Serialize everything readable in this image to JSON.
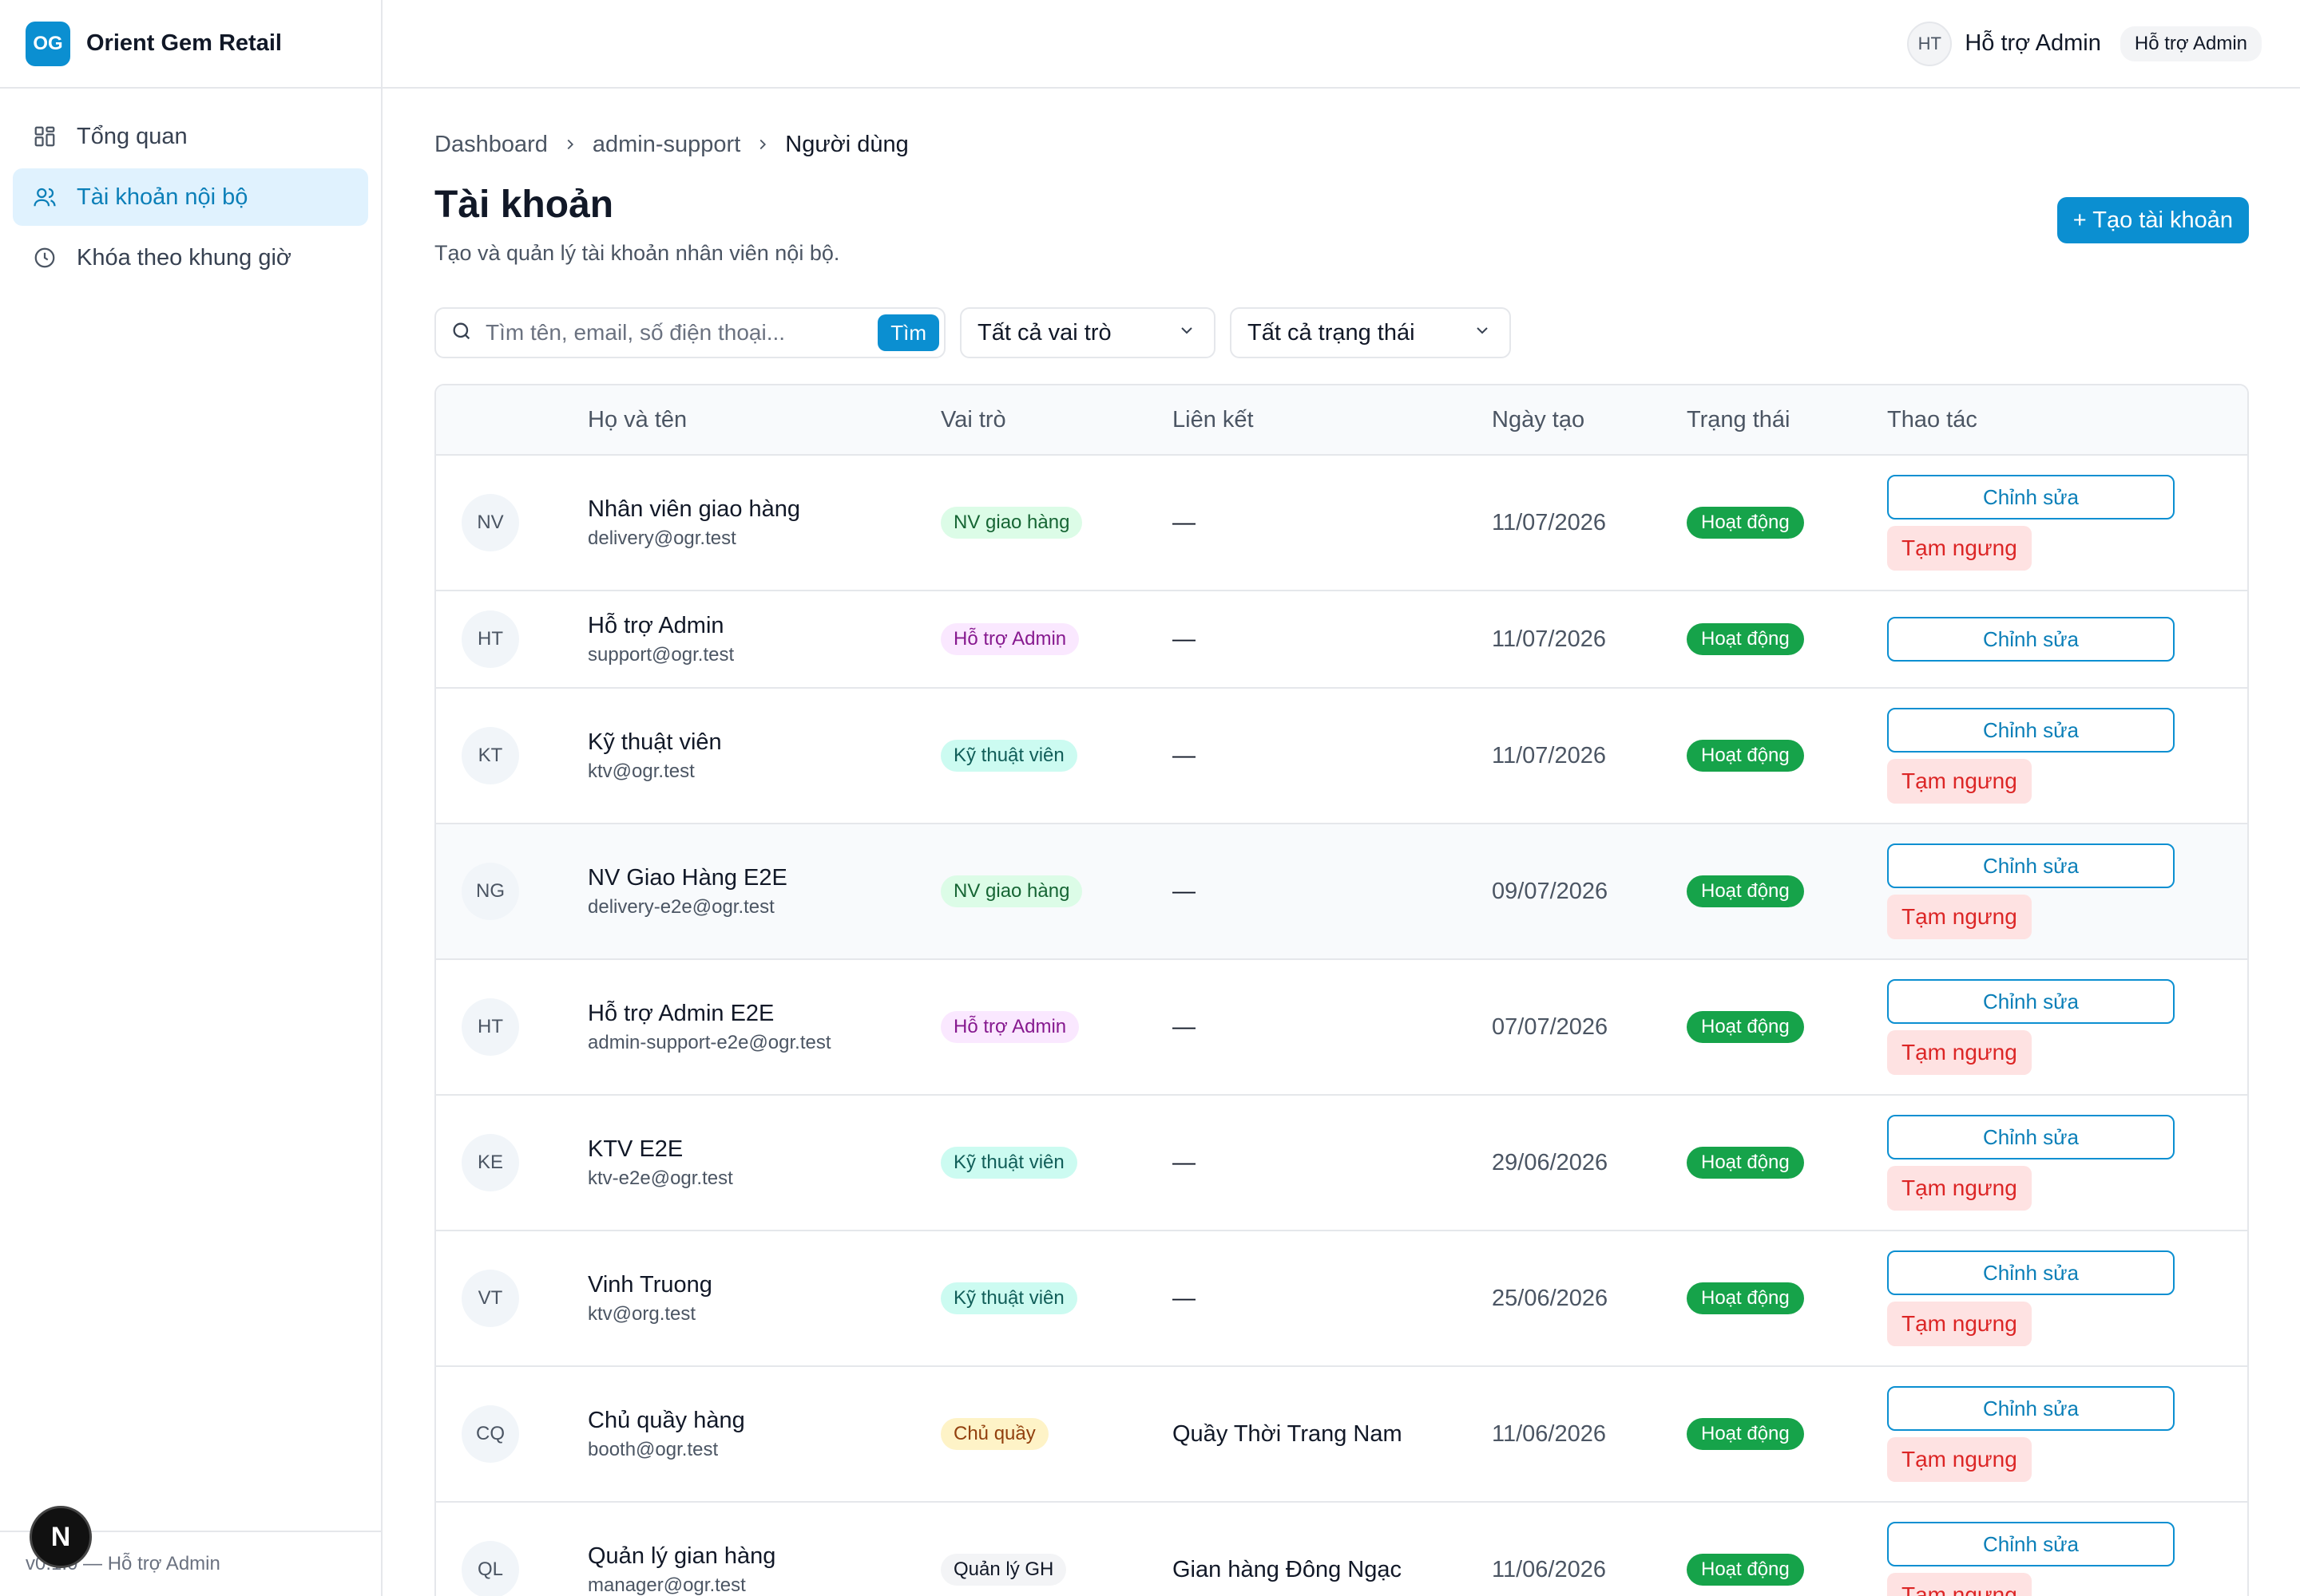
{
  "brand": {
    "logo": "OG",
    "name": "Orient Gem Retail"
  },
  "sidebar": {
    "items": [
      {
        "label": "Tổng quan",
        "icon": "grid-icon"
      },
      {
        "label": "Tài khoản nội bộ",
        "icon": "users-icon"
      },
      {
        "label": "Khóa theo khung giờ",
        "icon": "clock-icon"
      }
    ],
    "footer": "v0.1.0 — Hỗ trợ Admin"
  },
  "topbar": {
    "avatar": "HT",
    "user_name": "Hỗ trợ Admin",
    "role": "Hỗ trợ Admin"
  },
  "breadcrumb": [
    "Dashboard",
    "admin-support",
    "Người dùng"
  ],
  "page": {
    "title": "Tài khoản",
    "subtitle": "Tạo và quản lý tài khoản nhân viên nội bộ.",
    "create_label": "+ Tạo tài khoản"
  },
  "filters": {
    "search_placeholder": "Tìm tên, email, số điện thoại...",
    "search_button": "Tìm",
    "role_select": "Tất cả vai trò",
    "status_select": "Tất cả trạng thái"
  },
  "table": {
    "headers": [
      "Họ và tên",
      "Vai trò",
      "Liên kết",
      "Ngày tạo",
      "Trạng thái",
      "Thao tác"
    ],
    "edit_label": "Chỉnh sửa",
    "suspend_label": "Tạm ngưng",
    "rows": [
      {
        "initials": "NV",
        "name": "Nhân viên giao hàng",
        "email": "delivery@ogr.test",
        "role": "NV giao hàng",
        "link": "—",
        "date": "11/07/2026",
        "status": "Hoạt động"
      },
      {
        "initials": "HT",
        "name": "Hỗ trợ Admin",
        "email": "support@ogr.test",
        "role": "Hỗ trợ Admin",
        "link": "—",
        "date": "11/07/2026",
        "status": "Hoạt động"
      },
      {
        "initials": "KT",
        "name": "Kỹ thuật viên",
        "email": "ktv@ogr.test",
        "role": "Kỹ thuật viên",
        "link": "—",
        "date": "11/07/2026",
        "status": "Hoạt động"
      },
      {
        "initials": "NG",
        "name": "NV Giao Hàng E2E",
        "email": "delivery-e2e@ogr.test",
        "role": "NV giao hàng",
        "link": "—",
        "date": "09/07/2026",
        "status": "Hoạt động"
      },
      {
        "initials": "HT",
        "name": "Hỗ trợ Admin E2E",
        "email": "admin-support-e2e@ogr.test",
        "role": "Hỗ trợ Admin",
        "link": "—",
        "date": "07/07/2026",
        "status": "Hoạt động"
      },
      {
        "initials": "KE",
        "name": "KTV E2E",
        "email": "ktv-e2e@ogr.test",
        "role": "Kỹ thuật viên",
        "link": "—",
        "date": "29/06/2026",
        "status": "Hoạt động"
      },
      {
        "initials": "VT",
        "name": "Vinh Truong",
        "email": "ktv@org.test",
        "role": "Kỹ thuật viên",
        "link": "—",
        "date": "25/06/2026",
        "status": "Hoạt động"
      },
      {
        "initials": "CQ",
        "name": "Chủ quầy hàng",
        "email": "booth@ogr.test",
        "role": "Chủ quầy",
        "link": "Quầy Thời Trang Nam",
        "date": "11/06/2026",
        "status": "Hoạt động"
      },
      {
        "initials": "QL",
        "name": "Quản lý gian hàng",
        "email": "manager@ogr.test",
        "role": "Quản lý GH",
        "link": "Gian hàng Đông Ngạc",
        "date": "11/06/2026",
        "status": "Hoạt động"
      }
    ]
  },
  "next_badge": "N",
  "colors": {
    "accent": "#0b8fd1",
    "success": "#16a34a",
    "danger": "#dc2626"
  }
}
